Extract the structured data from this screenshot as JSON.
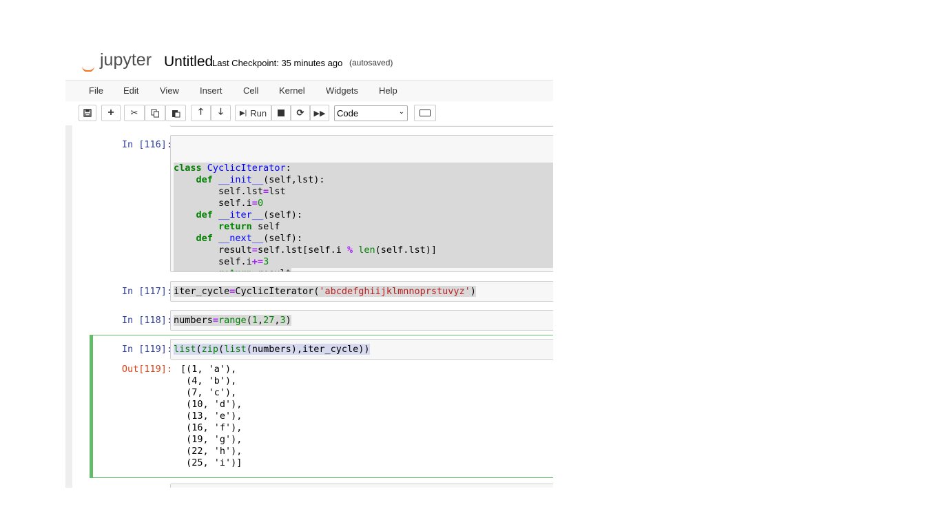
{
  "header": {
    "logo_text": "jupyter",
    "notebook_name": "Untitled",
    "checkpoint": "Last Checkpoint: 35 minutes ago",
    "autosaved": "(autosaved)"
  },
  "menu": [
    "File",
    "Edit",
    "View",
    "Insert",
    "Cell",
    "Kernel",
    "Widgets",
    "Help"
  ],
  "toolbar": {
    "run_label": "Run",
    "cell_type": "Code"
  },
  "cells": {
    "c116": {
      "prompt": "In [116]:",
      "lines": [
        "class CyclicIterator:",
        "    def __init__(self,lst):",
        "        self.lst=lst",
        "        self.i=0",
        "    def __iter__(self):",
        "        return self",
        "    def __next__(self):",
        "        result=self.lst[self.i % len(self.lst)]",
        "        self.i+=3",
        "        return result"
      ]
    },
    "c117": {
      "prompt": "In [117]:",
      "code": "iter_cycle=CyclicIterator('abcdefghiijklmnnoprstuvyz')"
    },
    "c118": {
      "prompt": "In [118]:",
      "code": "numbers=range(1,27,3)"
    },
    "c119": {
      "prompt": "In [119]:",
      "code": "list(zip(list(numbers),iter_cycle))",
      "out_prompt": "Out[119]:",
      "output": "[(1, 'a'),\n (4, 'b'),\n (7, 'c'),\n (10, 'd'),\n (13, 'e'),\n (16, 'f'),\n (19, 'g'),\n (22, 'h'),\n (25, 'i')]"
    }
  }
}
